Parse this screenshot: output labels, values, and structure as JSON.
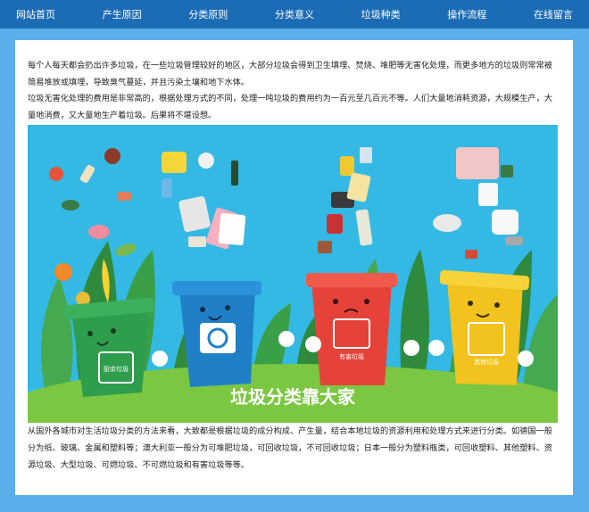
{
  "nav": {
    "items": [
      {
        "label": "网站首页"
      },
      {
        "label": "产生原因"
      },
      {
        "label": "分类原则"
      },
      {
        "label": "分类意义"
      },
      {
        "label": "垃圾种类"
      },
      {
        "label": "操作流程"
      },
      {
        "label": "在线留言"
      }
    ]
  },
  "content": {
    "para1": "每个人每天都会扔出许多垃圾，在一些垃圾管理较好的地区，大部分垃圾会得到卫生填埋、焚烧、堆肥等无害化处理，而更多地方的垃圾则常常被简易堆放或填埋，导致臭气蔓延，并且污染土壤和地下水体。",
    "para2": "垃圾无害化处理的费用是非常高的，根据处理方式的不同，处理一吨垃圾的费用约为一百元至几百元不等。人们大量地消耗资源，大规模生产，大量地消费，又大量地生产着垃圾。后果将不堪设想。",
    "banner": {
      "slogan": "垃圾分类靠大家",
      "bins": [
        {
          "label": "厨余垃圾",
          "color": "#2e9d4c"
        },
        {
          "label": "可回收物",
          "color": "#1f80c8"
        },
        {
          "label": "有害垃圾",
          "color": "#e5433a"
        },
        {
          "label": "其他垃圾",
          "color": "#f2c21f"
        }
      ]
    },
    "para3": "从国外各城市对生活垃圾分类的方法来看，大致都是根据垃圾的成分构成、产生量，结合本地垃圾的资源利用和处理方式来进行分类。如德国一般分为纸、玻璃、金属和塑料等；澳大利亚一般分为可堆肥垃圾，可回收垃圾，不可回收垃圾；日本一般分为塑料瓶类，可回收塑料、其他塑料、资源垃圾、大型垃圾、可燃垃圾、不可燃垃圾和有害垃圾等等。"
  }
}
